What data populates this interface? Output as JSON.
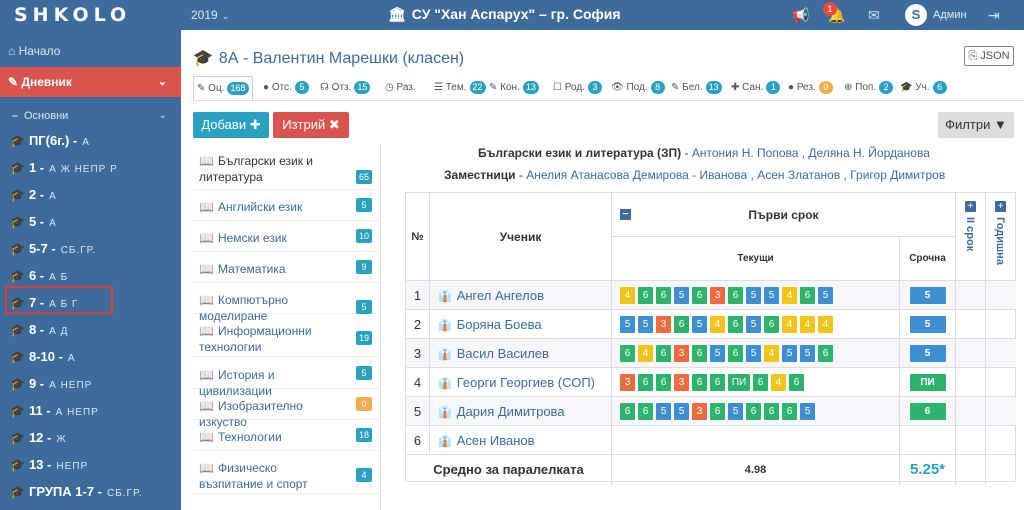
{
  "header": {
    "logo": "SHKOLO",
    "year": "2019",
    "school": "СУ \"Хан Аспарух\" – гр. София",
    "notification_count": "1",
    "avatar_letter": "S",
    "user": "Админ"
  },
  "sidebar": {
    "home": "Начало",
    "diary": "Дневник",
    "basic": "Основни",
    "grades": [
      {
        "name": "ПГ(6г.) -",
        "classes": "А"
      },
      {
        "name": "1 -",
        "classes": "А Ж НЕПР Р"
      },
      {
        "name": "2 -",
        "classes": "А"
      },
      {
        "name": "5 -",
        "classes": "А"
      },
      {
        "name": "5-7 -",
        "classes": "СБ.ГР."
      },
      {
        "name": "6 -",
        "classes": "А Б"
      },
      {
        "name": "7 -",
        "classes": "А Б Г"
      },
      {
        "name": "8 -",
        "classes": "А Д"
      },
      {
        "name": "8-10 -",
        "classes": "А"
      },
      {
        "name": "9 -",
        "classes": "А НЕПР"
      },
      {
        "name": "11 -",
        "classes": "А НЕПР"
      },
      {
        "name": "12 -",
        "classes": "Ж"
      },
      {
        "name": "13 -",
        "classes": "НЕПР"
      },
      {
        "name": "ГРУПА 1-7 -",
        "classes": "СБ.ГР."
      }
    ]
  },
  "page": {
    "title": "8А - Валентин Марешки (класен)",
    "json_label": "JSON"
  },
  "tabs": [
    {
      "label": "Оц.",
      "count": "168",
      "active": true
    },
    {
      "label": "Отс.",
      "count": "5"
    },
    {
      "label": "Отз.",
      "count": "15"
    },
    {
      "label": "Раз.",
      "count": ""
    },
    {
      "label": "Тем.",
      "count": "22"
    },
    {
      "label": "Кон.",
      "count": "13"
    },
    {
      "label": "Род.",
      "count": "3"
    },
    {
      "label": "Под.",
      "count": "8"
    },
    {
      "label": "Бел.",
      "count": "13"
    },
    {
      "label": "Сан.",
      "count": "1"
    },
    {
      "label": "Рез.",
      "count": "0",
      "orange": true
    },
    {
      "label": "Поп.",
      "count": "2"
    },
    {
      "label": "Уч.",
      "count": "6"
    }
  ],
  "actions": {
    "add": "Добави",
    "delete": "Изтрий",
    "filter": "Филтри"
  },
  "subjects": [
    {
      "name": "Български език и литература",
      "count": "65",
      "active": true
    },
    {
      "name": "Английски език",
      "count": "5"
    },
    {
      "name": "Немски език",
      "count": "10"
    },
    {
      "name": "Математика",
      "count": "9"
    },
    {
      "name": "Компютърно моделиране",
      "count": "5"
    },
    {
      "name": "Информационни технологии",
      "count": "19"
    },
    {
      "name": "История и цивилизации",
      "count": "5"
    },
    {
      "name": "Изобразително изкуство",
      "count": "0",
      "orange": true
    },
    {
      "name": "Технологии",
      "count": "18"
    },
    {
      "name": "Физическо възпитание и спорт",
      "count": "4"
    }
  ],
  "info": {
    "subject_label": "Български език и литература (ЗП)",
    "subject_sep": " - ",
    "teachers": "Антония Н. Попова , Деляна Н. Йорданова",
    "deputies_label": "Заместници",
    "deputies": "Анелия Атанасова Демирова - Иванова , Асен Златанов , Григор Димитров"
  },
  "table": {
    "col_no": "№",
    "col_student": "Ученик",
    "col_term1": "Първи срок",
    "col_current": "Текущи",
    "col_urgent": "Срочна",
    "col_term2": "II срок",
    "col_year": "Годишна",
    "avg_label": "Средно за паралелката",
    "avg_current": "4.98",
    "avg_urgent": "5.25*",
    "rows": [
      {
        "no": "1",
        "name": "Ангел Ангелов",
        "grades": [
          "4",
          "6",
          "6",
          "5",
          "6",
          "3",
          "6",
          "5",
          "5",
          "4",
          "6",
          "5"
        ],
        "urgent": "5"
      },
      {
        "no": "2",
        "name": "Боряна Боева",
        "grades": [
          "5",
          "5",
          "3",
          "6",
          "5",
          "4",
          "6",
          "5",
          "6",
          "4",
          "4",
          "4"
        ],
        "urgent": "5"
      },
      {
        "no": "3",
        "name": "Васил Василев",
        "grades": [
          "6",
          "4",
          "6",
          "3",
          "6",
          "5",
          "6",
          "5",
          "4",
          "5",
          "5",
          "6"
        ],
        "urgent": "5"
      },
      {
        "no": "4",
        "name": "Георги Георгиев (СОП)",
        "grades": [
          "3",
          "6",
          "6",
          "3",
          "6",
          "6",
          "ПИ",
          "6",
          "4",
          "6"
        ],
        "urgent": "ПИ"
      },
      {
        "no": "5",
        "name": "Дария Димитрова",
        "grades": [
          "6",
          "6",
          "5",
          "5",
          "3",
          "6",
          "5",
          "6",
          "6",
          "6",
          "5"
        ],
        "urgent": "6"
      },
      {
        "no": "6",
        "name": "Асен Иванов",
        "grades": [],
        "urgent": ""
      }
    ]
  },
  "colors": {
    "primary": "#3c6b9c",
    "danger": "#d9534f",
    "info": "#2aa1c0",
    "grade6": "#2db36b",
    "grade5": "#3d8fd1",
    "grade4": "#f0c419",
    "grade3": "#ee6a3f"
  }
}
